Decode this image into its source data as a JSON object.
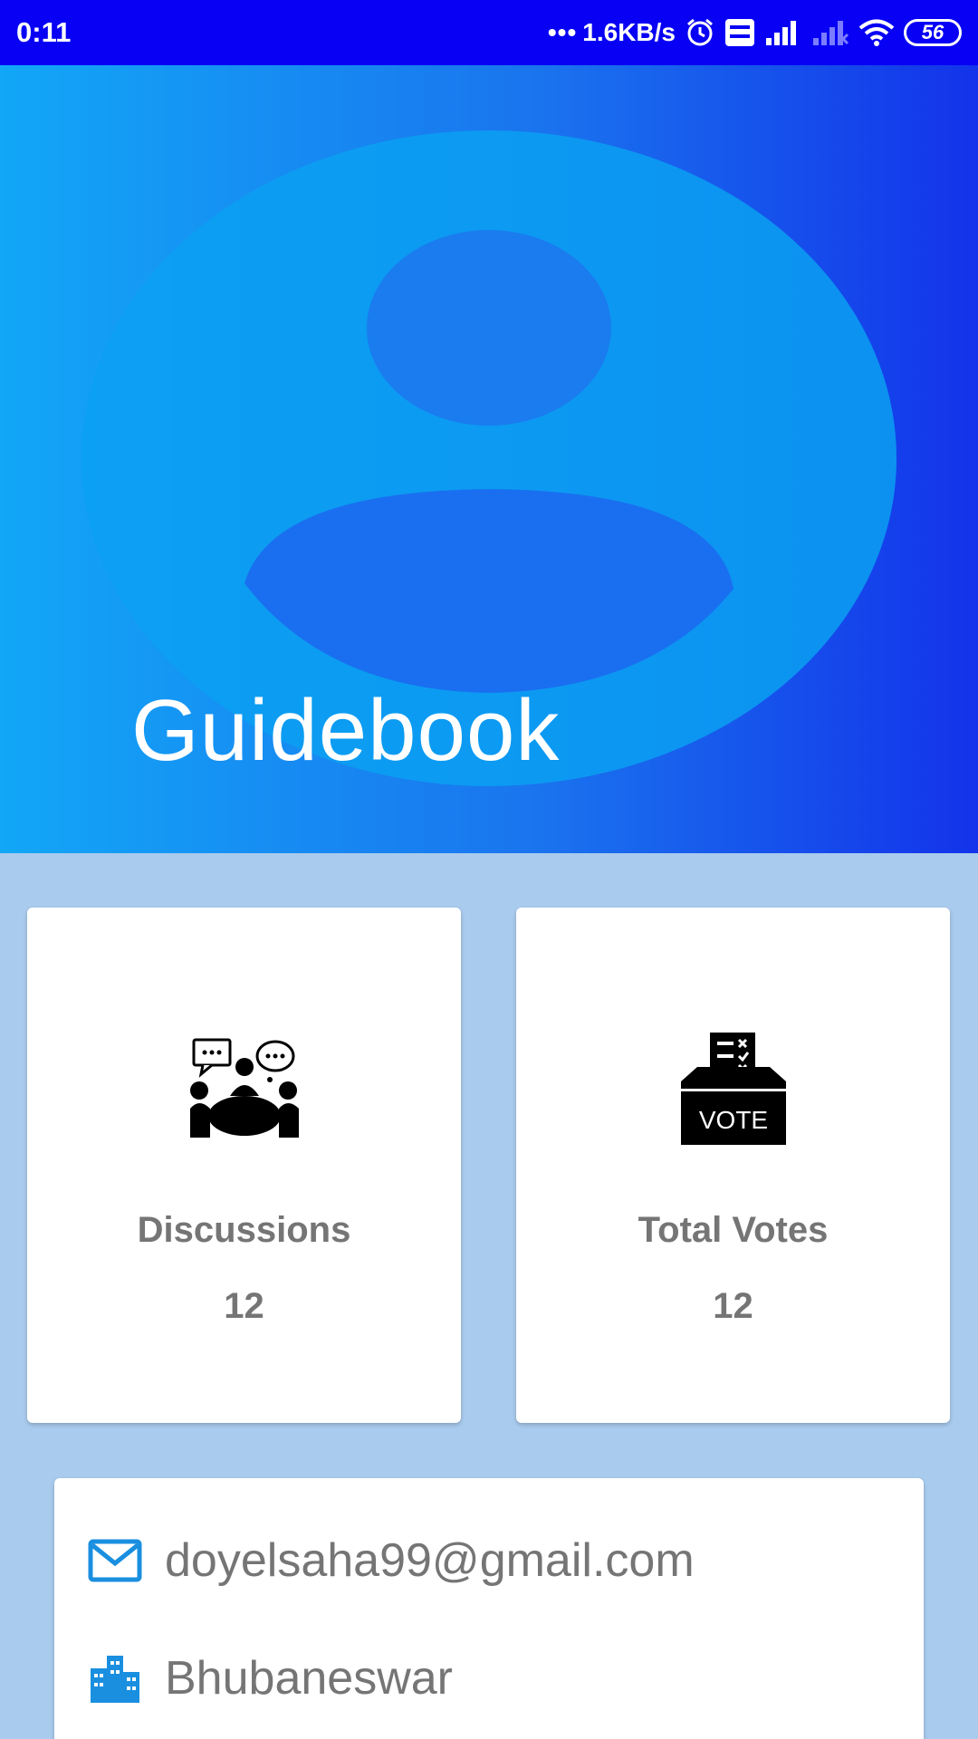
{
  "status_bar": {
    "time": "0:11",
    "speed": "1.6KB/s",
    "battery": "56"
  },
  "header": {
    "title": "Guidebook"
  },
  "stats": [
    {
      "label": "Discussions",
      "value": "12",
      "icon": "discussion-meeting-icon"
    },
    {
      "label": "Total Votes",
      "value": "12",
      "icon": "ballot-box-icon",
      "icon_text": "VOTE"
    }
  ],
  "profile": {
    "email": "doyelsaha99@gmail.com",
    "city": "Bhubaneswar"
  },
  "colors": {
    "status_bar": "#0700f4",
    "header_start": "#12a7f7",
    "header_end": "#1333ea",
    "page_bg": "#a9cbee",
    "accent_icon": "#1a8fe0",
    "text_grey": "#757575"
  }
}
